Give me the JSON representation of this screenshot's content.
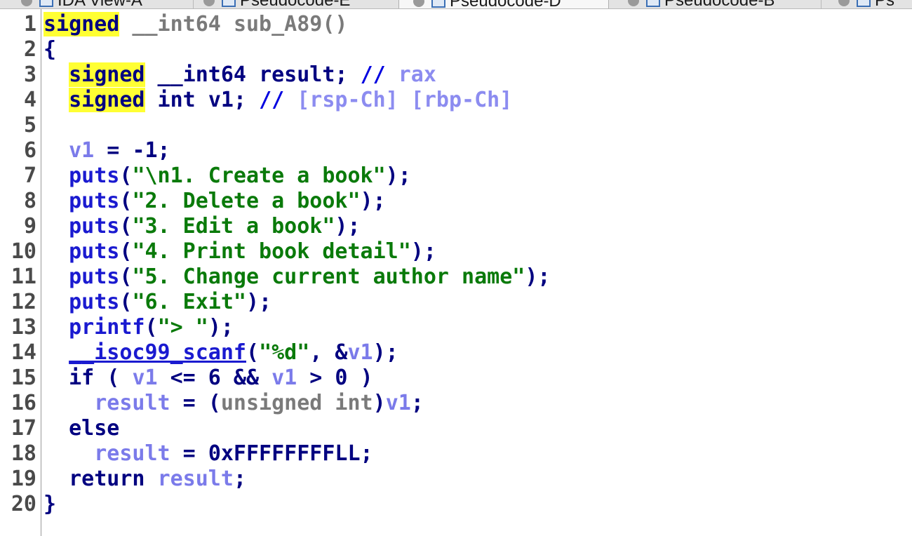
{
  "tabs": [
    {
      "label": "IDA View-A",
      "active": false
    },
    {
      "label": "Pseudocode-E",
      "active": false
    },
    {
      "label": "Pseudocode-D",
      "active": true
    },
    {
      "label": "Pseudocode-B",
      "active": false
    },
    {
      "label": "Ps",
      "active": false
    }
  ],
  "code": {
    "line_numbers": [
      "1",
      "2",
      "3",
      "4",
      "5",
      "6",
      "7",
      "8",
      "9",
      "10",
      "11",
      "12",
      "13",
      "14",
      "15",
      "16",
      "17",
      "18",
      "19",
      "20"
    ],
    "l1": {
      "signed": "signed",
      "type": " __int64 ",
      "name": "sub_A89()"
    },
    "l2": {
      "brace": "{"
    },
    "l3": {
      "signed": "signed",
      "type": " __int64 ",
      "name": "result",
      "semi": "; ",
      "cmt": "// ",
      "reg": "rax"
    },
    "l4": {
      "signed": "signed",
      "type": " int ",
      "name": "v1",
      "semi": "; ",
      "cmt": "// ",
      "reg": "[rsp-Ch] [rbp-Ch]"
    },
    "l6": {
      "var": "v1",
      "op": " = ",
      "val": "-1;"
    },
    "l7": {
      "fn": "puts",
      "open": "(",
      "str": "\"\\n1. Create a book\"",
      "close": ");"
    },
    "l8": {
      "fn": "puts",
      "open": "(",
      "str": "\"2. Delete a book\"",
      "close": ");"
    },
    "l9": {
      "fn": "puts",
      "open": "(",
      "str": "\"3. Edit a book\"",
      "close": ");"
    },
    "l10": {
      "fn": "puts",
      "open": "(",
      "str": "\"4. Print book detail\"",
      "close": ");"
    },
    "l11": {
      "fn": "puts",
      "open": "(",
      "str": "\"5. Change current author name\"",
      "close": ");"
    },
    "l12": {
      "fn": "puts",
      "open": "(",
      "str": "\"6. Exit\"",
      "close": ");"
    },
    "l13": {
      "fn": "printf",
      "open": "(",
      "str": "\"> \"",
      "close": ");"
    },
    "l14": {
      "fn": "__isoc99_scanf",
      "open": "(",
      "str": "\"%d\"",
      "mid": ", &",
      "var": "v1",
      "close": ");"
    },
    "l15": {
      "kw": "if",
      "p1": " ( ",
      "v1": "v1",
      "op1": " <= 6 && ",
      "v2": "v1",
      "op2": " > 0 )"
    },
    "l16": {
      "var": "result",
      "op": " = (",
      "cast": "unsigned int",
      "close": ")",
      "v": "v1",
      "semi": ";"
    },
    "l17": {
      "kw": "else"
    },
    "l18": {
      "var": "result",
      "op": " = ",
      "val": "0xFFFFFFFFLL;"
    },
    "l19": {
      "kw": "return",
      "sp": " ",
      "var": "result",
      "semi": ";"
    },
    "l20": {
      "brace": "}"
    }
  }
}
